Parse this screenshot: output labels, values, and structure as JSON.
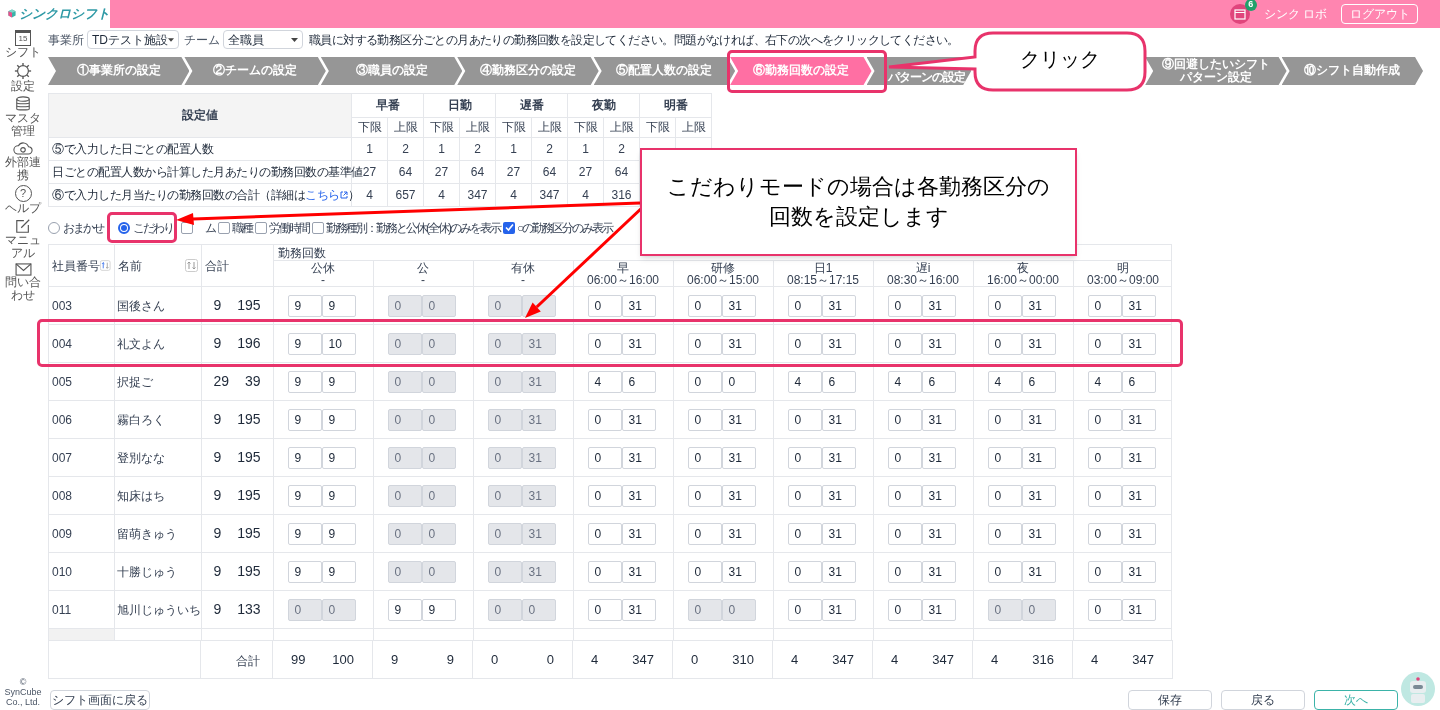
{
  "app": {
    "logo": "シンクロシフト",
    "notification_count": "6",
    "user": "シンク ロボ",
    "logout": "ログアウト"
  },
  "sidebar": [
    {
      "kind": "calendar",
      "label": "シフト",
      "icon_text": "15"
    },
    {
      "kind": "gear",
      "label": "設定"
    },
    {
      "kind": "database",
      "label": "マスタ管理"
    },
    {
      "kind": "cloud",
      "label": "外部連携"
    },
    {
      "kind": "help",
      "label": "ヘルプ",
      "icon_text": "?"
    },
    {
      "kind": "edit",
      "label": "マニュアル"
    },
    {
      "kind": "mail",
      "label": "問い合わせ"
    }
  ],
  "copyright": "© SynCube Co., Ltd.",
  "filters": {
    "office_label": "事業所",
    "office": "TDテスト施設",
    "team_label": "チーム",
    "team": "全職員",
    "instruction": "職員に対する勤務区分ごとの月あたりの勤務回数を設定してください。問題がなければ、右下の次へをクリックしてください。"
  },
  "steps": [
    {
      "label": "①事業所の設定",
      "selected": false
    },
    {
      "label": "②チームの設定",
      "selected": false
    },
    {
      "label": "③職員の設定",
      "selected": false
    },
    {
      "label": "④勤務区分の設定",
      "selected": false
    },
    {
      "label": "⑤配置人数の設定",
      "selected": false
    },
    {
      "label": "⑥勤務回数の設定",
      "selected": true
    },
    {
      "label": "パターンの設定",
      "selected": false
    },
    {
      "label": "⑨回避したいシフトパターン設定",
      "selected": false
    },
    {
      "label": "⑩シフト自動作成",
      "selected": false
    }
  ],
  "summary": {
    "header": "設定値",
    "groups": [
      {
        "name": "早番",
        "lower": "下限",
        "upper": "上限"
      },
      {
        "name": "日勤",
        "lower": "下限",
        "upper": "上限"
      },
      {
        "name": "遅番",
        "lower": "下限",
        "upper": "上限"
      },
      {
        "name": "夜勤",
        "lower": "下限",
        "upper": "上限"
      },
      {
        "name": "明番",
        "lower": "下限",
        "upper": "上限"
      }
    ],
    "rows": [
      {
        "label": "⑤で入力した日ごとの配置人数",
        "values": [
          "1",
          "2",
          "1",
          "2",
          "1",
          "2",
          "1",
          "2"
        ]
      },
      {
        "label": "日ごとの配置人数から計算した月あたりの勤務回数の基準値",
        "values": [
          "27",
          "64",
          "27",
          "64",
          "27",
          "64",
          "27",
          "64"
        ]
      },
      {
        "label": "⑥で入力した月当たりの勤務回数の合計（詳細は ",
        "link": "こちら",
        "label_end": "）",
        "values": [
          "4",
          "657",
          "4",
          "347",
          "4",
          "347",
          "4",
          "316"
        ]
      }
    ]
  },
  "mode_options": [
    {
      "label": "おまかせ",
      "selected": false
    },
    {
      "label": "こだわり",
      "selected": true
    }
  ],
  "display_options": [
    {
      "label": "ム",
      "checked": false
    },
    {
      "label": "職種",
      "checked": false
    },
    {
      "label": "労働時間",
      "checked": false
    },
    {
      "label": "勤務種別：勤務と公休(全休)のみを表示",
      "checked": false
    },
    {
      "label": "○の勤務区分のみ表示",
      "checked": true
    }
  ],
  "table": {
    "columns": {
      "id": "社員番号",
      "name": "名前",
      "total": "合計",
      "group": "勤務回数"
    },
    "shifts": [
      {
        "name": "公休",
        "time": "-"
      },
      {
        "name": "公",
        "time": "-"
      },
      {
        "name": "有休",
        "time": "-"
      },
      {
        "name": "早",
        "time": "06:00～16:00"
      },
      {
        "name": "研修",
        "time": "06:00～15:00"
      },
      {
        "name": "日1",
        "time": "08:15～17:15"
      },
      {
        "name": "遅i",
        "time": "08:30～16:00"
      },
      {
        "name": "夜",
        "time": "16:00～00:00"
      },
      {
        "name": "明",
        "time": "03:00～09:00"
      }
    ],
    "rows": [
      {
        "id": "003",
        "name": "国後さん",
        "total_min": "9",
        "total_max": "195",
        "cells": [
          {
            "min": "9",
            "max": "9",
            "disabled": false
          },
          {
            "min": "0",
            "max": "0",
            "disabled": true
          },
          {
            "min": "0",
            "disabled": true
          },
          {
            "min": "0",
            "max": "31",
            "disabled": false
          },
          {
            "min": "0",
            "max": "31",
            "disabled": false
          },
          {
            "min": "0",
            "max": "31",
            "disabled": false
          },
          {
            "min": "0",
            "max": "31",
            "disabled": false
          },
          {
            "min": "0",
            "max": "31",
            "disabled": false
          },
          {
            "min": "0",
            "max": "31",
            "disabled": false
          }
        ]
      },
      {
        "id": "004",
        "name": "礼文よん",
        "total_min": "9",
        "total_max": "196",
        "cells": [
          {
            "min": "9",
            "max": "10",
            "disabled": false
          },
          {
            "min": "0",
            "max": "0",
            "disabled": true
          },
          {
            "min": "0",
            "max": "31",
            "disabled": true
          },
          {
            "min": "0",
            "max": "31",
            "disabled": false
          },
          {
            "min": "0",
            "max": "31",
            "disabled": false
          },
          {
            "min": "0",
            "max": "31",
            "disabled": false
          },
          {
            "min": "0",
            "max": "31",
            "disabled": false
          },
          {
            "min": "0",
            "max": "31",
            "disabled": false
          },
          {
            "min": "0",
            "max": "31",
            "disabled": false
          }
        ]
      },
      {
        "id": "005",
        "name": "択捉ご",
        "total_min": "29",
        "total_max": "39",
        "cells": [
          {
            "min": "9",
            "max": "9",
            "disabled": false
          },
          {
            "min": "0",
            "max": "0",
            "disabled": true
          },
          {
            "min": "0",
            "max": "31",
            "disabled": true
          },
          {
            "min": "4",
            "max": "6",
            "disabled": false
          },
          {
            "min": "0",
            "max": "0",
            "disabled": false
          },
          {
            "min": "4",
            "max": "6",
            "disabled": false
          },
          {
            "min": "4",
            "max": "6",
            "disabled": false
          },
          {
            "min": "4",
            "max": "6",
            "disabled": false
          },
          {
            "min": "4",
            "max": "6",
            "disabled": false
          }
        ]
      },
      {
        "id": "006",
        "name": "霧白ろく",
        "total_min": "9",
        "total_max": "195",
        "cells": [
          {
            "min": "9",
            "max": "9",
            "disabled": false
          },
          {
            "min": "0",
            "max": "0",
            "disabled": true
          },
          {
            "min": "0",
            "max": "31",
            "disabled": true
          },
          {
            "min": "0",
            "max": "31",
            "disabled": false
          },
          {
            "min": "0",
            "max": "31",
            "disabled": false
          },
          {
            "min": "0",
            "max": "31",
            "disabled": false
          },
          {
            "min": "0",
            "max": "31",
            "disabled": false
          },
          {
            "min": "0",
            "max": "31",
            "disabled": false
          },
          {
            "min": "0",
            "max": "31",
            "disabled": false
          }
        ]
      },
      {
        "id": "007",
        "name": "登別なな",
        "total_min": "9",
        "total_max": "195",
        "cells": [
          {
            "min": "9",
            "max": "9",
            "disabled": false
          },
          {
            "min": "0",
            "max": "0",
            "disabled": true
          },
          {
            "min": "0",
            "max": "31",
            "disabled": true
          },
          {
            "min": "0",
            "max": "31",
            "disabled": false
          },
          {
            "min": "0",
            "max": "31",
            "disabled": false
          },
          {
            "min": "0",
            "max": "31",
            "disabled": false
          },
          {
            "min": "0",
            "max": "31",
            "disabled": false
          },
          {
            "min": "0",
            "max": "31",
            "disabled": false
          },
          {
            "min": "0",
            "max": "31",
            "disabled": false
          }
        ]
      },
      {
        "id": "008",
        "name": "知床はち",
        "total_min": "9",
        "total_max": "195",
        "cells": [
          {
            "min": "9",
            "max": "9",
            "disabled": false
          },
          {
            "min": "0",
            "max": "0",
            "disabled": true
          },
          {
            "min": "0",
            "max": "31",
            "disabled": true
          },
          {
            "min": "0",
            "max": "31",
            "disabled": false
          },
          {
            "min": "0",
            "max": "31",
            "disabled": false
          },
          {
            "min": "0",
            "max": "31",
            "disabled": false
          },
          {
            "min": "0",
            "max": "31",
            "disabled": false
          },
          {
            "min": "0",
            "max": "31",
            "disabled": false
          },
          {
            "min": "0",
            "max": "31",
            "disabled": false
          }
        ]
      },
      {
        "id": "009",
        "name": "留萌きゅう",
        "total_min": "9",
        "total_max": "195",
        "cells": [
          {
            "min": "9",
            "max": "9",
            "disabled": false
          },
          {
            "min": "0",
            "max": "0",
            "disabled": true
          },
          {
            "min": "0",
            "max": "31",
            "disabled": true
          },
          {
            "min": "0",
            "max": "31",
            "disabled": false
          },
          {
            "min": "0",
            "max": "31",
            "disabled": false
          },
          {
            "min": "0",
            "max": "31",
            "disabled": false
          },
          {
            "min": "0",
            "max": "31",
            "disabled": false
          },
          {
            "min": "0",
            "max": "31",
            "disabled": false
          },
          {
            "min": "0",
            "max": "31",
            "disabled": false
          }
        ]
      },
      {
        "id": "010",
        "name": "十勝じゅう",
        "total_min": "9",
        "total_max": "195",
        "cells": [
          {
            "min": "9",
            "max": "9",
            "disabled": false
          },
          {
            "min": "0",
            "max": "0",
            "disabled": true
          },
          {
            "min": "0",
            "max": "31",
            "disabled": true
          },
          {
            "min": "0",
            "max": "31",
            "disabled": false
          },
          {
            "min": "0",
            "max": "31",
            "disabled": false
          },
          {
            "min": "0",
            "max": "31",
            "disabled": false
          },
          {
            "min": "0",
            "max": "31",
            "disabled": false
          },
          {
            "min": "0",
            "max": "31",
            "disabled": false
          },
          {
            "min": "0",
            "max": "31",
            "disabled": false
          }
        ]
      },
      {
        "id": "011",
        "name": "旭川じゅういち",
        "total_min": "9",
        "total_max": "133",
        "cells": [
          {
            "min": "0",
            "max": "0",
            "disabled": true
          },
          {
            "min": "9",
            "max": "9",
            "disabled": false
          },
          {
            "min": "0",
            "max": "0",
            "disabled": true
          },
          {
            "min": "0",
            "max": "31",
            "disabled": false
          },
          {
            "min": "0",
            "max": "0",
            "disabled": true
          },
          {
            "min": "0",
            "max": "31",
            "disabled": false
          },
          {
            "min": "0",
            "max": "31",
            "disabled": false
          },
          {
            "min": "0",
            "max": "0",
            "disabled": true
          },
          {
            "min": "0",
            "max": "31",
            "disabled": false
          }
        ]
      }
    ],
    "footer": {
      "label": "合計",
      "cells": [
        {
          "min": "99",
          "max": "100"
        },
        {
          "min": "9",
          "max": "9"
        },
        {
          "min": "0",
          "max": "0"
        },
        {
          "min": "4",
          "max": "347"
        },
        {
          "min": "0",
          "max": "310"
        },
        {
          "min": "4",
          "max": "347"
        },
        {
          "min": "4",
          "max": "347"
        },
        {
          "min": "4",
          "max": "316"
        },
        {
          "min": "4",
          "max": "347"
        }
      ]
    }
  },
  "buttons": {
    "back_to_shift": "シフト画面に戻る",
    "actions": [
      {
        "label": "保存",
        "kind": "default"
      },
      {
        "label": "戻る",
        "kind": "default"
      },
      {
        "label": "次へ",
        "kind": "primary"
      }
    ]
  },
  "annotations": {
    "click_callout": "クリック",
    "mode_callout": [
      "こだわりモードの場合は各勤務区分の",
      "回数を設定します"
    ]
  }
}
